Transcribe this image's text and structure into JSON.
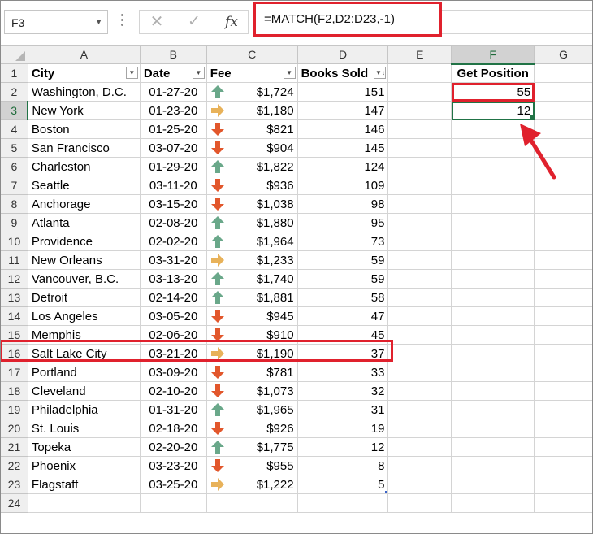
{
  "name_box": {
    "value": "F3"
  },
  "formula_bar": {
    "formula": "=MATCH(F2,D2:D23,-1)",
    "fx_label": "fx"
  },
  "columns": [
    "A",
    "B",
    "C",
    "D",
    "E",
    "F",
    "G"
  ],
  "headers": {
    "city": "City",
    "date": "Date",
    "fee": "Fee",
    "books": "Books Sold",
    "get_position": "Get Position"
  },
  "rows": [
    {
      "n": "2",
      "city": "Washington, D.C.",
      "date": "01-27-20",
      "trend": "up",
      "fee": "$1,724",
      "books": "151"
    },
    {
      "n": "3",
      "city": "New York",
      "date": "01-23-20",
      "trend": "side",
      "fee": "$1,180",
      "books": "147"
    },
    {
      "n": "4",
      "city": "Boston",
      "date": "01-25-20",
      "trend": "down",
      "fee": "$821",
      "books": "146"
    },
    {
      "n": "5",
      "city": "San Francisco",
      "date": "03-07-20",
      "trend": "down",
      "fee": "$904",
      "books": "145"
    },
    {
      "n": "6",
      "city": "Charleston",
      "date": "01-29-20",
      "trend": "up",
      "fee": "$1,822",
      "books": "124"
    },
    {
      "n": "7",
      "city": "Seattle",
      "date": "03-11-20",
      "trend": "down",
      "fee": "$936",
      "books": "109"
    },
    {
      "n": "8",
      "city": "Anchorage",
      "date": "03-15-20",
      "trend": "down",
      "fee": "$1,038",
      "books": "98"
    },
    {
      "n": "9",
      "city": "Atlanta",
      "date": "02-08-20",
      "trend": "up",
      "fee": "$1,880",
      "books": "95"
    },
    {
      "n": "10",
      "city": "Providence",
      "date": "02-02-20",
      "trend": "up",
      "fee": "$1,964",
      "books": "73"
    },
    {
      "n": "11",
      "city": "New Orleans",
      "date": "03-31-20",
      "trend": "side",
      "fee": "$1,233",
      "books": "59"
    },
    {
      "n": "12",
      "city": "Vancouver, B.C.",
      "date": "03-13-20",
      "trend": "up",
      "fee": "$1,740",
      "books": "59"
    },
    {
      "n": "13",
      "city": "Detroit",
      "date": "02-14-20",
      "trend": "up",
      "fee": "$1,881",
      "books": "58"
    },
    {
      "n": "14",
      "city": "Los Angeles",
      "date": "03-05-20",
      "trend": "down",
      "fee": "$945",
      "books": "47"
    },
    {
      "n": "15",
      "city": "Memphis",
      "date": "02-06-20",
      "trend": "down",
      "fee": "$910",
      "books": "45"
    },
    {
      "n": "16",
      "city": "Salt Lake City",
      "date": "03-21-20",
      "trend": "side",
      "fee": "$1,190",
      "books": "37"
    },
    {
      "n": "17",
      "city": "Portland",
      "date": "03-09-20",
      "trend": "down",
      "fee": "$781",
      "books": "33"
    },
    {
      "n": "18",
      "city": "Cleveland",
      "date": "02-10-20",
      "trend": "down",
      "fee": "$1,073",
      "books": "32"
    },
    {
      "n": "19",
      "city": "Philadelphia",
      "date": "01-31-20",
      "trend": "up",
      "fee": "$1,965",
      "books": "31"
    },
    {
      "n": "20",
      "city": "St. Louis",
      "date": "02-18-20",
      "trend": "down",
      "fee": "$926",
      "books": "19"
    },
    {
      "n": "21",
      "city": "Topeka",
      "date": "02-20-20",
      "trend": "up",
      "fee": "$1,775",
      "books": "12"
    },
    {
      "n": "22",
      "city": "Phoenix",
      "date": "03-23-20",
      "trend": "down",
      "fee": "$955",
      "books": "8"
    },
    {
      "n": "23",
      "city": "Flagstaff",
      "date": "03-25-20",
      "trend": "side",
      "fee": "$1,222",
      "books": "5"
    }
  ],
  "f_values": {
    "f2": "55",
    "f3": "12"
  },
  "row_labels": {
    "r1": "1",
    "r24": "24"
  },
  "colors": {
    "up": "#6aa88a",
    "down": "#e2572c",
    "side": "#e8b25a",
    "highlight": "#e0212d",
    "selection": "#217346"
  }
}
